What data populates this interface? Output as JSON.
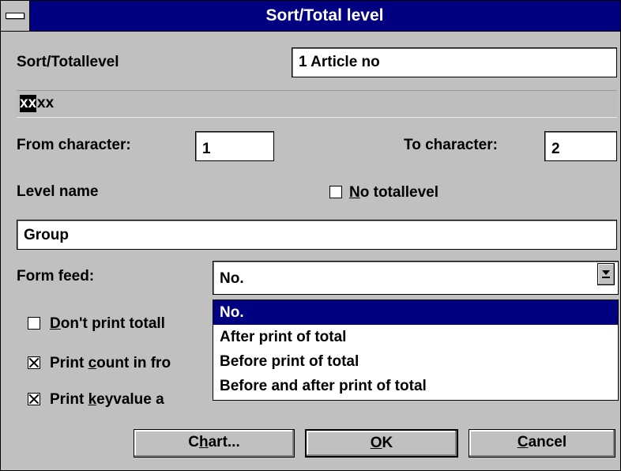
{
  "window": {
    "title": "Sort/Total level"
  },
  "sort_total_level": {
    "label": "Sort/Totallevel",
    "value": "1 Article no"
  },
  "key_pattern": {
    "highlighted": "xx",
    "rest": "xx"
  },
  "from_character": {
    "label": "From character:",
    "value": "1"
  },
  "to_character": {
    "label": "To character:",
    "value": "2"
  },
  "level_name": {
    "label": "Level name",
    "value": "Group"
  },
  "no_totallevel": {
    "mnemonic": "N",
    "label_rest": "o totallevel",
    "checked": false
  },
  "form_feed": {
    "label": "Form feed:",
    "selected": "No.",
    "options": [
      "No.",
      "After print of total",
      "Before print of total",
      "Before and after print of total"
    ]
  },
  "checkboxes": {
    "dont_print_total": {
      "mnemonic": "D",
      "label_rest": "on't print totall",
      "checked": false
    },
    "print_count": {
      "pre": "Print ",
      "mnemonic": "c",
      "label_rest": "ount in fro",
      "checked": true
    },
    "print_keyvalue": {
      "pre": "Print ",
      "mnemonic": "k",
      "label_rest": "eyvalue a",
      "checked": true
    }
  },
  "buttons": {
    "chart": {
      "pre": "C",
      "mnemonic": "h",
      "rest": "art..."
    },
    "ok": {
      "mnemonic": "O",
      "rest": "K"
    },
    "cancel": {
      "mnemonic": "C",
      "rest": "ancel"
    }
  }
}
